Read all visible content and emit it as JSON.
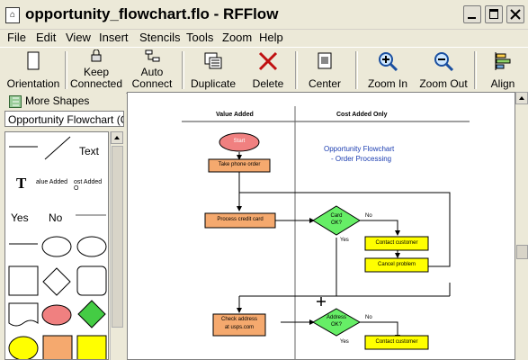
{
  "window": {
    "title": "opportunity_flowchart.flo - RFFlow"
  },
  "menu": [
    "File",
    "Edit",
    "View",
    "Insert",
    "Stencils",
    "Tools",
    "Zoom",
    "Help"
  ],
  "toolbar": {
    "orientation": "Orientation",
    "keep_connected_1": "Keep",
    "keep_connected_2": "Connected",
    "auto_connect_1": "Auto",
    "auto_connect_2": "Connect",
    "duplicate": "Duplicate",
    "delete": "Delete",
    "center": "Center",
    "zoom_in": "Zoom In",
    "zoom_out": "Zoom Out",
    "align": "Align"
  },
  "left_panel": {
    "more_shapes": "More Shapes",
    "library": "Opportunity Flowchart (C",
    "palette_text": "Text",
    "palette_value_added": "alue Added",
    "palette_cost_added": "ost Added O",
    "palette_yes": "Yes",
    "palette_no": "No",
    "palette_T": "T"
  },
  "chart": {
    "col_value_added": "Value Added",
    "col_cost_added": "Cost Added Only",
    "title_line1": "Opportunity Flowchart",
    "title_line2": "- Order Processing",
    "start": "Start",
    "take_phone_order": "Take phone order",
    "process_credit_card": "Process credit card",
    "card_ok_1": "Card",
    "card_ok_2": "OK?",
    "contact_customer": "Contact customer",
    "cancel_problem": "Cancel problem",
    "check_address_1": "Check address",
    "check_address_2": "at usps.com",
    "address_ok_1": "Address",
    "address_ok_2": "OK?",
    "contact_customer_2": "Contact customer",
    "no": "No",
    "yes": "Yes"
  },
  "colors": {
    "start_fill": "#f08080",
    "process_fill": "#f5a96e",
    "decision_fill": "#66ee66",
    "contact_fill": "#ffff00",
    "title_blue": "#1a3cb0"
  }
}
